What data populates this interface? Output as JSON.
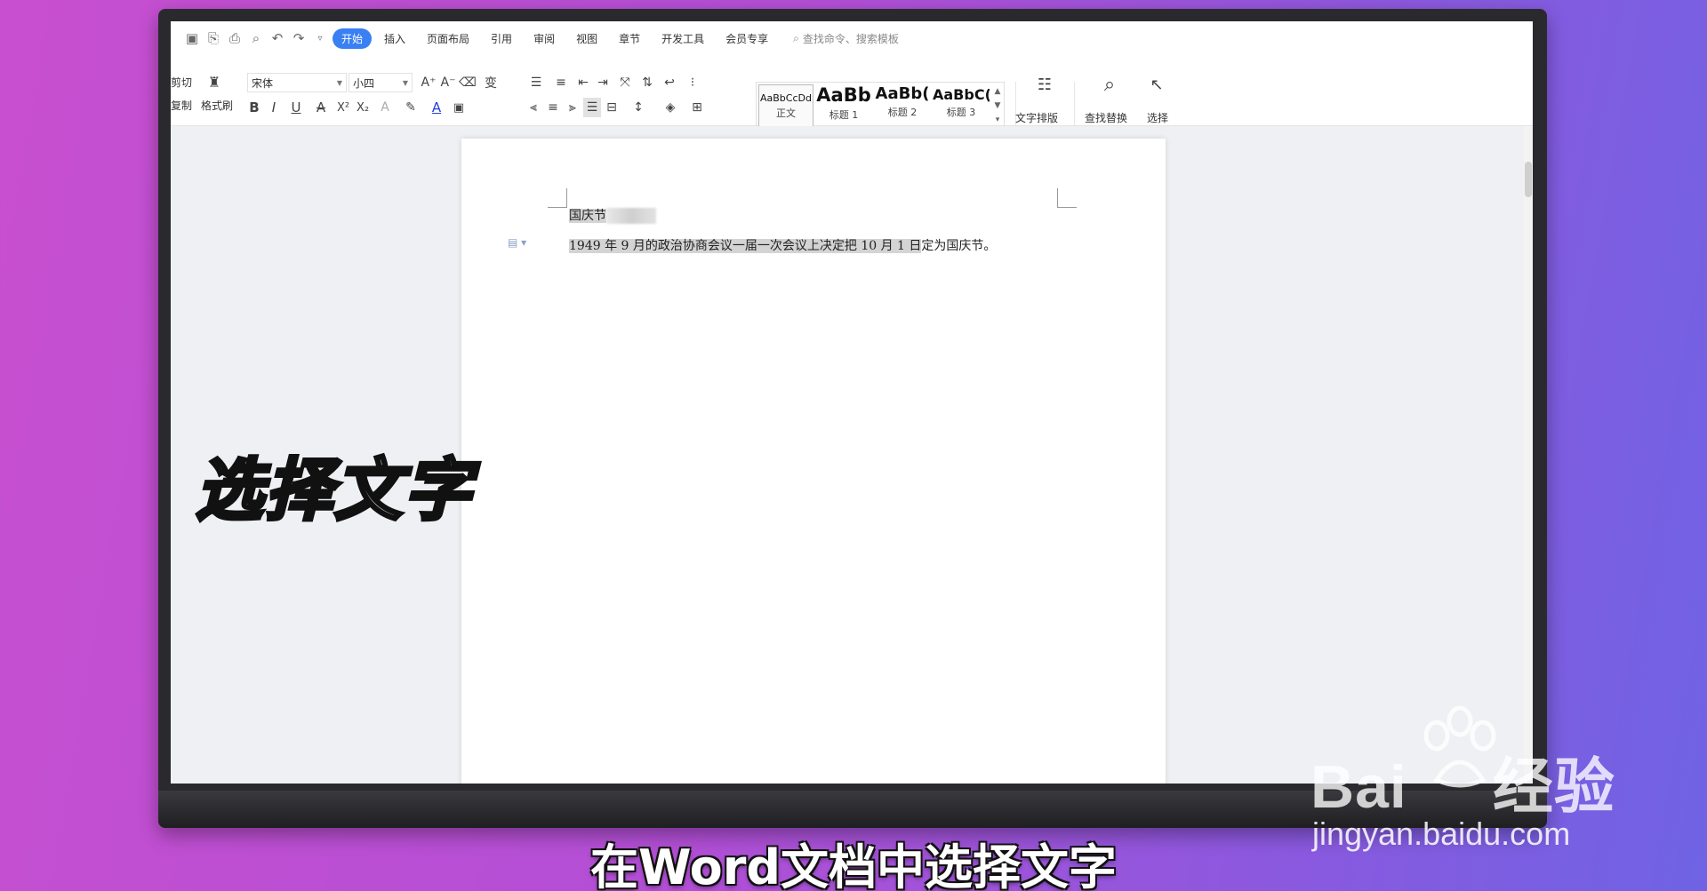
{
  "toolbar_tabs": {
    "start": "开始",
    "insert": "插入",
    "layout": "页面布局",
    "references": "引用",
    "review": "审阅",
    "view": "视图",
    "section": "章节",
    "developer": "开发工具",
    "member": "会员专享",
    "search_placeholder": "查找命令、搜索模板"
  },
  "ribbon": {
    "cut": "剪切",
    "copy": "复制",
    "format_painter": "格式刷",
    "font_name": "宋体",
    "font_size": "小四",
    "styles": [
      {
        "sample": "AaBbCcDd",
        "label": "正文"
      },
      {
        "sample": "AaBb",
        "label": "标题 1"
      },
      {
        "sample": "AaBb(",
        "label": "标题 2"
      },
      {
        "sample": "AaBbC(",
        "label": "标题 3"
      }
    ],
    "text_layout": "文字排版",
    "find_replace": "查找替换",
    "select": "选择"
  },
  "document": {
    "line1": "国庆节",
    "line2_selected": "1949 年 9 月的政治协商会议一届一次会议上决定把 10 月 1 日",
    "line2_rest": "定为国庆节。"
  },
  "overlay": {
    "big_caption": "选择文字",
    "subtitle": "在Word文档中选择文字",
    "watermark_brand": "Bai",
    "watermark_brand_rest": "经验",
    "watermark_url": "jingyan.baidu.com"
  },
  "colors": {
    "accent": "#3a80f2",
    "selection": "#d4d4d4",
    "background_gradient_start": "#c84fd0",
    "background_gradient_end": "#6f63e4"
  }
}
